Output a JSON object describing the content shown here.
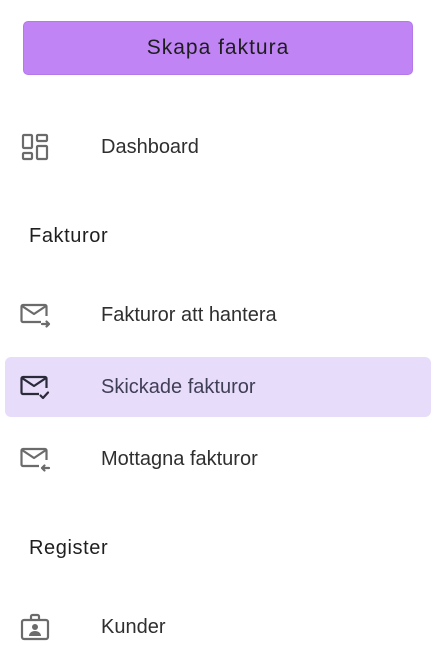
{
  "sidebar": {
    "create_button": "Skapa faktura",
    "dashboard": {
      "label": "Dashboard",
      "icon": "dashboard-icon"
    },
    "sections": [
      {
        "title": "Fakturor",
        "items": [
          {
            "label": "Fakturor att hantera",
            "icon": "mail-outgoing-icon",
            "active": false
          },
          {
            "label": "Skickade fakturor",
            "icon": "mail-check-icon",
            "active": true
          },
          {
            "label": "Mottagna fakturor",
            "icon": "mail-incoming-icon",
            "active": false
          }
        ]
      },
      {
        "title": "Register",
        "items": [
          {
            "label": "Kunder",
            "icon": "contact-badge-icon",
            "active": false
          }
        ]
      }
    ]
  },
  "colors": {
    "accent": "#c084f5",
    "active_bg": "#e8dcfb",
    "icon_gray": "#6b6b6b",
    "icon_active": "#2a2a3a"
  }
}
